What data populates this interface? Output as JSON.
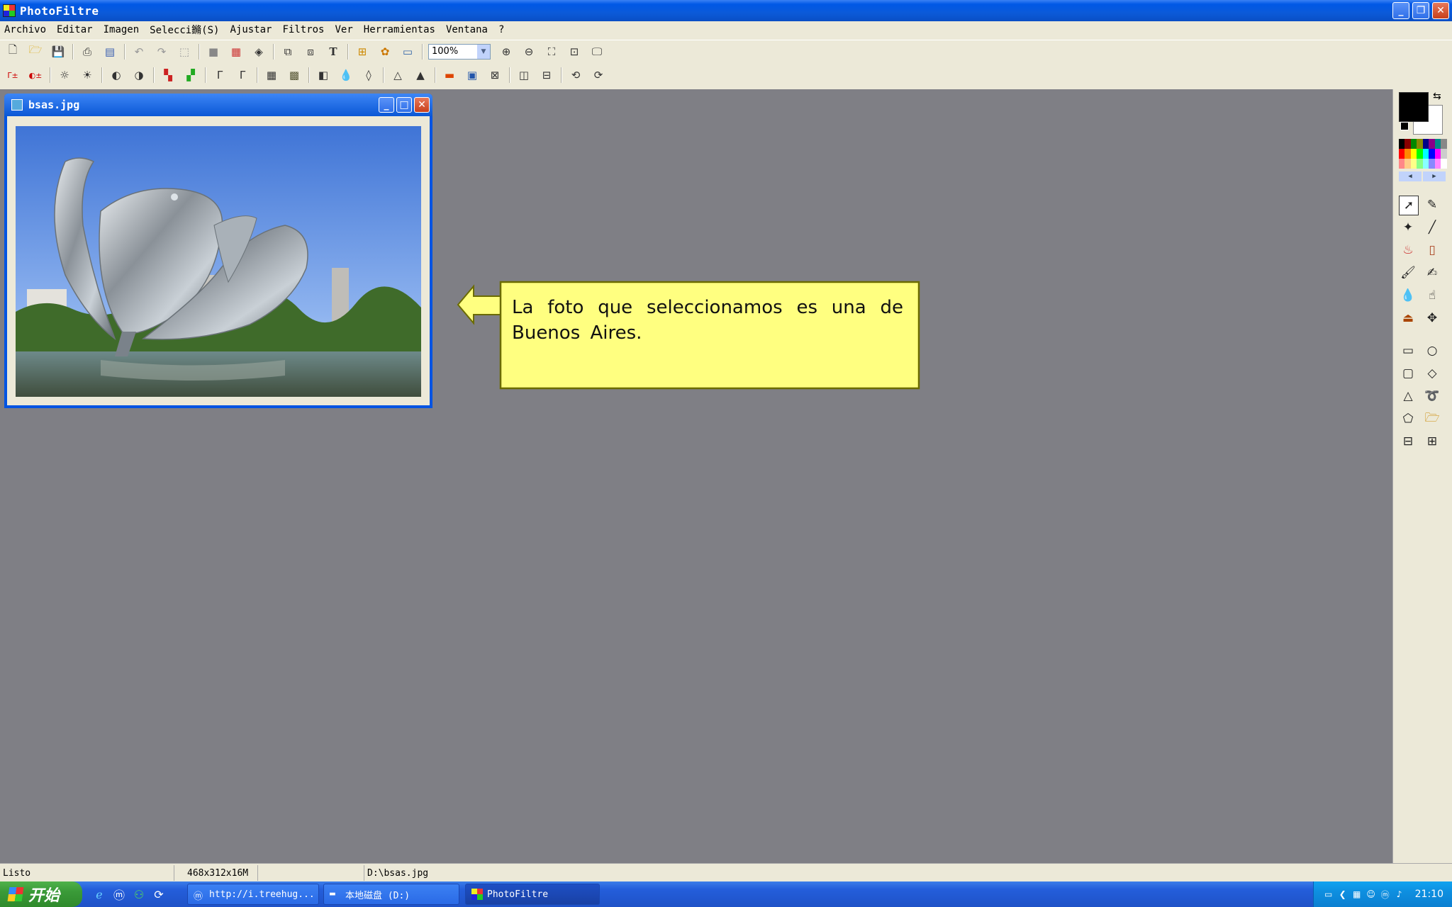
{
  "app": {
    "title": "PhotoFiltre"
  },
  "menu": [
    "Archivo",
    "Editar",
    "Imagen",
    "Selecci鏅(S)",
    "Ajustar",
    "Filtros",
    "Ver",
    "Herramientas",
    "Ventana",
    "?"
  ],
  "toolbar": {
    "zoom_value": "100%",
    "text_tool_glyph": "T"
  },
  "icons_toolbar1": [
    "new-icon",
    "open-icon",
    "save-icon",
    "print-icon",
    "scan-icon",
    "undo-icon",
    "redo-icon",
    "crop-icon",
    "grayscale-icon",
    "palette-icon",
    "effects-icon",
    "filter-icon",
    "filter2-icon",
    "text-icon",
    "explorer-icon",
    "plugin-icon",
    "window-icon",
    "zoom-in-icon",
    "zoom-out-icon",
    "fit-icon",
    "actual-size-icon",
    "fullscreen-icon"
  ],
  "document": {
    "title": "bsas.jpg"
  },
  "callout": {
    "text": "La foto que seleccionamos es una  de Buenos Aires.",
    "fill": "#ffff80",
    "border": "#6b6b00"
  },
  "colors": {
    "foreground": "#000000",
    "background": "#ffffff"
  },
  "statusbar": {
    "state": "Listo",
    "dimensions": "468x312x16M",
    "path": "D:\\bsas.jpg"
  },
  "taskbar": {
    "start_label": "开始",
    "tasks": [
      {
        "label": "http://i.treehug...",
        "active": false
      },
      {
        "label": "本地磁盘 (D:)",
        "active": false
      },
      {
        "label": "PhotoFiltre",
        "active": true
      }
    ],
    "clock": "21:10"
  }
}
